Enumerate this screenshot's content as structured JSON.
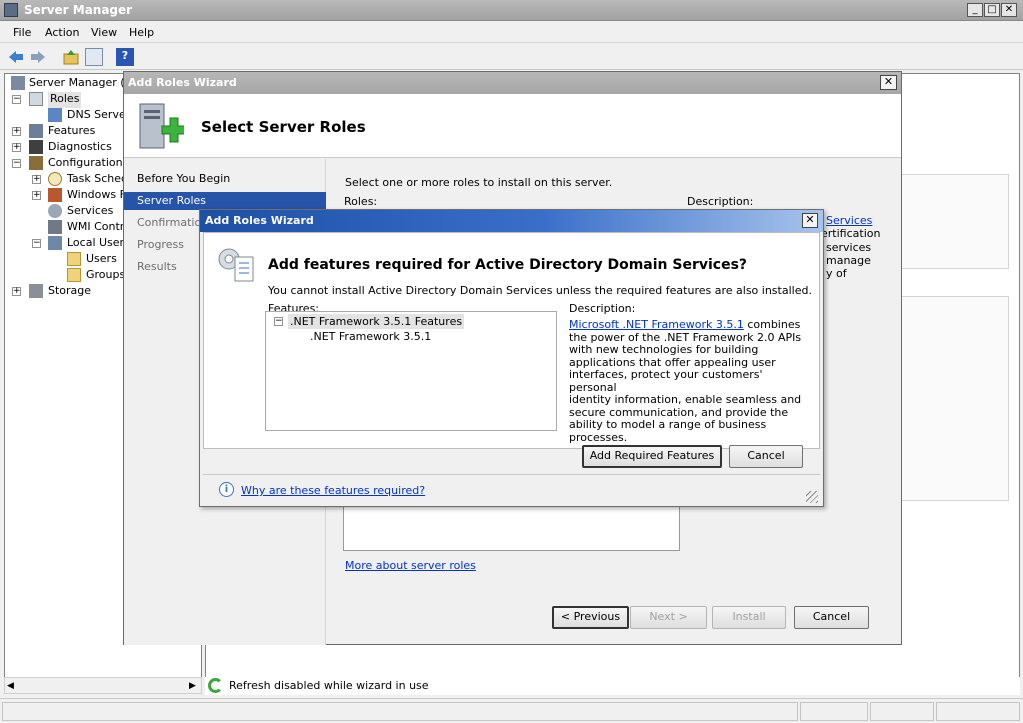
{
  "app": {
    "title": "Server Manager"
  },
  "menu": [
    "File",
    "Action",
    "View",
    "Help"
  ],
  "tree": {
    "root": "Server Manager (U",
    "roles": "Roles",
    "dns": "DNS Server",
    "features": "Features",
    "diagnostics": "Diagnostics",
    "configuration": "Configuration",
    "task_scheduler": "Task Sched",
    "windows_firewall": "Windows Fi",
    "services": "Services",
    "wmi": "WMI Contro",
    "local_users": "Local Users",
    "users": "Users",
    "groups": "Groups",
    "storage": "Storage"
  },
  "right_pane": {
    "status": "Refresh disabled while wizard in use"
  },
  "wizard": {
    "title": "Add Roles Wizard",
    "header": "Select Server Roles",
    "nav": [
      "Before You Begin",
      "Server Roles",
      "Confirmation",
      "Progress",
      "Results"
    ],
    "instruction": "Select one or more roles to install on this server.",
    "roles_label": "Roles:",
    "description_label": "Description:",
    "desc_fragments": [
      "Services",
      "ertification",
      "services",
      "manage",
      "y of"
    ],
    "more_link": "More about server roles",
    "buttons": {
      "previous": "< Previous",
      "next": "Next >",
      "install": "Install",
      "cancel": "Cancel"
    }
  },
  "dialog": {
    "title": "Add Roles Wizard",
    "heading": "Add features required for Active Directory Domain Services?",
    "subtext": "You cannot install Active Directory Domain Services unless the required features are also installed.",
    "features_label": "Features:",
    "description_label": "Description:",
    "feature_parent": ".NET Framework 3.5.1 Features",
    "feature_child": ".NET Framework 3.5.1",
    "desc_link": "Microsoft .NET Framework 3.5.1",
    "desc_lines": [
      " combines",
      "the power of the .NET Framework 2.0 APIs",
      "with new technologies for building",
      "applications that offer appealing user",
      "interfaces, protect your customers' personal",
      "identity information, enable seamless and",
      "secure communication, and provide the",
      "ability to model a range of business",
      "processes."
    ],
    "add_button": "Add Required Features",
    "cancel_button": "Cancel",
    "help_link": "Why are these features required?"
  }
}
